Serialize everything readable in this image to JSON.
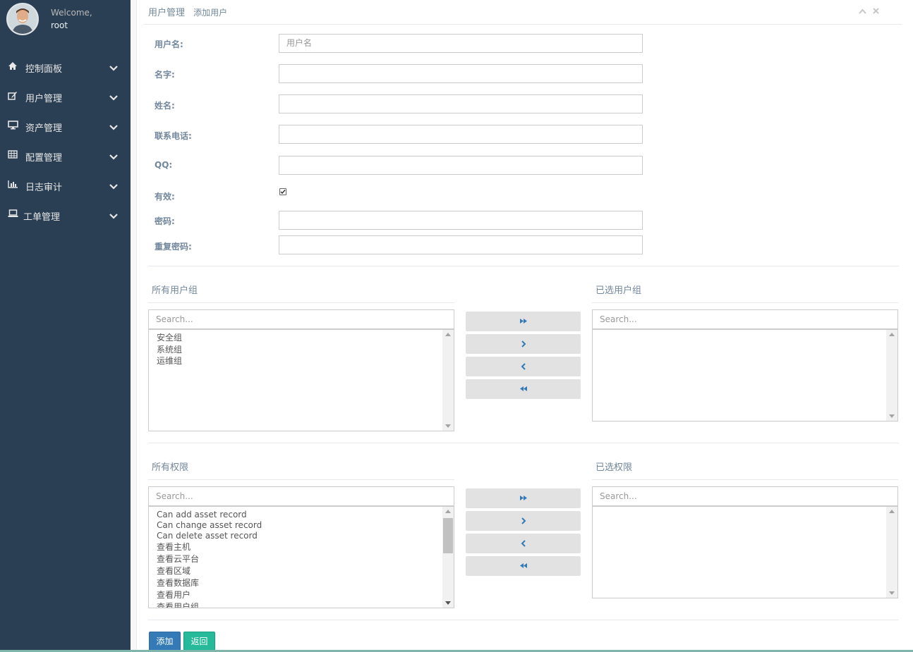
{
  "user": {
    "welcome": "Welcome,",
    "name": "root"
  },
  "sidebar": {
    "items": [
      {
        "label": "控制面板",
        "icon": "home-icon"
      },
      {
        "label": "用户管理",
        "icon": "edit-icon"
      },
      {
        "label": "资产管理",
        "icon": "desktop-icon"
      },
      {
        "label": "配置管理",
        "icon": "table-icon"
      },
      {
        "label": "日志审计",
        "icon": "bar-chart-icon"
      },
      {
        "label": "工单管理",
        "icon": "laptop-icon"
      }
    ]
  },
  "panel": {
    "title": "用户管理",
    "subtitle": "添加用户"
  },
  "form": {
    "username": {
      "label": "用户名:",
      "placeholder": "用户名",
      "value": ""
    },
    "first_name": {
      "label": "名字:",
      "value": ""
    },
    "last_name": {
      "label": "姓名:",
      "value": ""
    },
    "phone": {
      "label": "联系电话:",
      "value": ""
    },
    "qq": {
      "label": "QQ:",
      "value": ""
    },
    "active": {
      "label": "有效:",
      "checked": true
    },
    "password": {
      "label": "密码:",
      "value": ""
    },
    "password2": {
      "label": "重复密码:",
      "value": ""
    }
  },
  "groups": {
    "available_title": "所有用户组",
    "selected_title": "已选用户组",
    "search_placeholder": "Search...",
    "available": [
      "安全组",
      "系统组",
      "运维组"
    ],
    "selected": []
  },
  "permissions": {
    "available_title": "所有权限",
    "selected_title": "已选权限",
    "search_placeholder": "Search...",
    "available": [
      "Can add asset record",
      "Can change asset record",
      "Can delete asset record",
      "查看主机",
      "查看云平台",
      "查看区域",
      "查看数据库",
      "查看用户",
      "查看用户组"
    ],
    "selected": []
  },
  "buttons": {
    "add": "添加",
    "back": "返回"
  },
  "colors": {
    "sidebar": "#2a3f54",
    "primary": "#337ab7",
    "success": "#26b99a"
  }
}
